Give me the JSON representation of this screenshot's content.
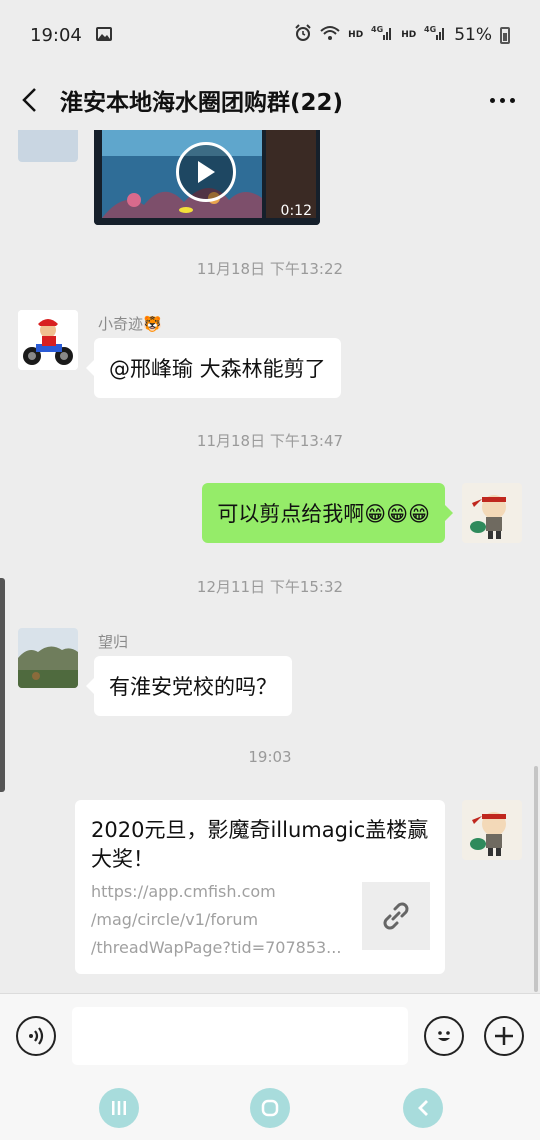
{
  "status": {
    "time": "19:04",
    "hd": "HD",
    "net": "4G",
    "battery": "51%"
  },
  "header": {
    "title": "淮安本地海水圈团购群(22)"
  },
  "video": {
    "duration": "0:12"
  },
  "messages": [
    {
      "timestamp": "11月18日 下午13:22",
      "sender": "小奇迹🐯",
      "text": "@邢峰瑜  大森林能剪了"
    },
    {
      "timestamp": "11月18日 下午13:47",
      "text": "可以剪点给我啊😁😁😁"
    },
    {
      "timestamp": "12月11日 下午15:32",
      "sender": "望归",
      "text": "有淮安党校的吗？"
    },
    {
      "timestamp": "19:03"
    }
  ],
  "link_card": {
    "title": "2020元旦，影魔奇illumagic盖楼赢大奖！",
    "url_lines": [
      "https://app.cmfish.com",
      "/mag/circle/v1/forum",
      "/threadWapPage?tid=707853..."
    ]
  },
  "icons": {
    "back": "back-arrow-icon",
    "more": "more-dots-icon",
    "voice": "voice-icon",
    "emoji": "emoji-icon",
    "plus": "plus-icon",
    "link": "link-icon",
    "play": "play-icon"
  },
  "colors": {
    "background": "#ededed",
    "sent_bubble": "#95ec69",
    "nav_button": "#a8dcdc"
  }
}
